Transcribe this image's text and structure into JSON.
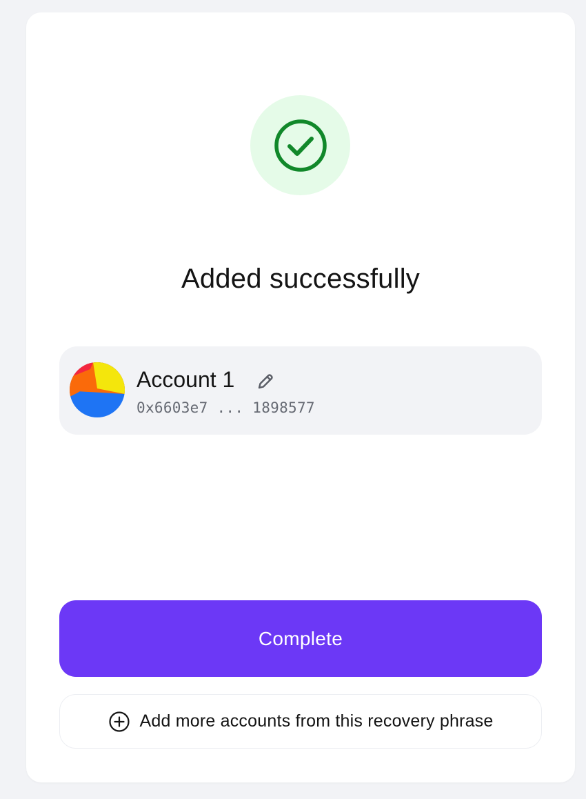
{
  "status": {
    "icon": "check-circle-icon",
    "title": "Added successfully",
    "colors": {
      "badge_bg": "#e5fbe8",
      "check": "#11882a"
    }
  },
  "account": {
    "name": "Account 1",
    "address": "0x6603e7 ... 1898577",
    "avatar": "multicolor-jazzicon",
    "edit_icon": "pencil-icon"
  },
  "actions": {
    "complete_label": "Complete",
    "add_more_label": "Add more accounts from this recovery phrase",
    "add_more_icon": "plus-circle-icon",
    "primary_color": "#6c38f6"
  }
}
